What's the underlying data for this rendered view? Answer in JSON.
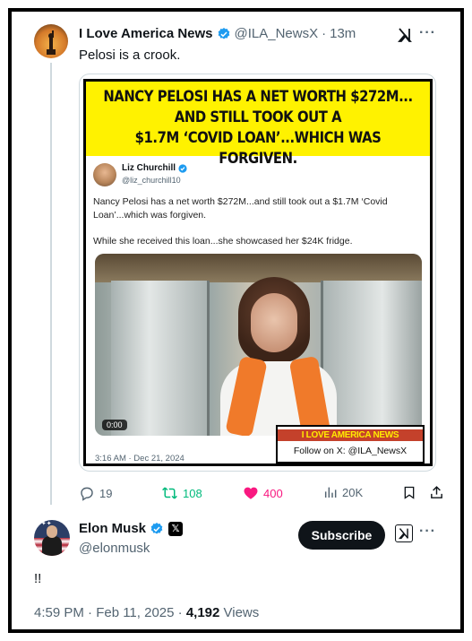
{
  "colors": {
    "verified_blue": "#1d9bf0",
    "retweet_green": "#00ba7c",
    "like_pink": "#f91880",
    "secondary_text": "#536471",
    "banner_yellow": "#fff200",
    "watermark_red": "#c4412b"
  },
  "tweet1": {
    "name": "I Love America News",
    "handle": "@ILA_NewsX",
    "dot": "·",
    "time": "13m",
    "text": "Pelosi is a crook.",
    "meme": {
      "headline_line1": "NANCY PELOSI HAS A NET WORTH $272M...",
      "headline_line2": "AND STILL TOOK OUT A",
      "headline_line3": "$1.7M ‘COVID LOAN’...WHICH WAS FORGIVEN.",
      "quoted": {
        "name": "Liz Churchill",
        "handle": "@liz_churchill10",
        "paragraph1": "Nancy Pelosi has a net worth $272M...and still took out a $1.7M ‘Covid Loan’...which was forgiven.",
        "paragraph2": "While she received this loan...she showcased her $24K fridge.",
        "video_time": "0:00",
        "date": "3:16 AM · Dec 21, 2024"
      },
      "watermark_title": "I LOVE AMERICA NEWS",
      "watermark_sub": "Follow on X: @ILA_NewsX"
    },
    "actions": {
      "replies": "19",
      "retweets": "108",
      "likes": "400",
      "views": "20K"
    },
    "icons": [
      "verified-badge-icon",
      "grok-icon",
      "more-icon",
      "reply-icon",
      "retweet-icon",
      "heart-icon",
      "views-icon",
      "bookmark-icon",
      "share-icon"
    ]
  },
  "tweet2": {
    "name": "Elon Musk",
    "handle": "@elonmusk",
    "x_badge": "𝕏",
    "subscribe_label": "Subscribe",
    "text": "!!",
    "timestamp": "4:59 PM · Feb 11, 2025 · ",
    "views_count": "4,192",
    "views_label": " Views"
  }
}
